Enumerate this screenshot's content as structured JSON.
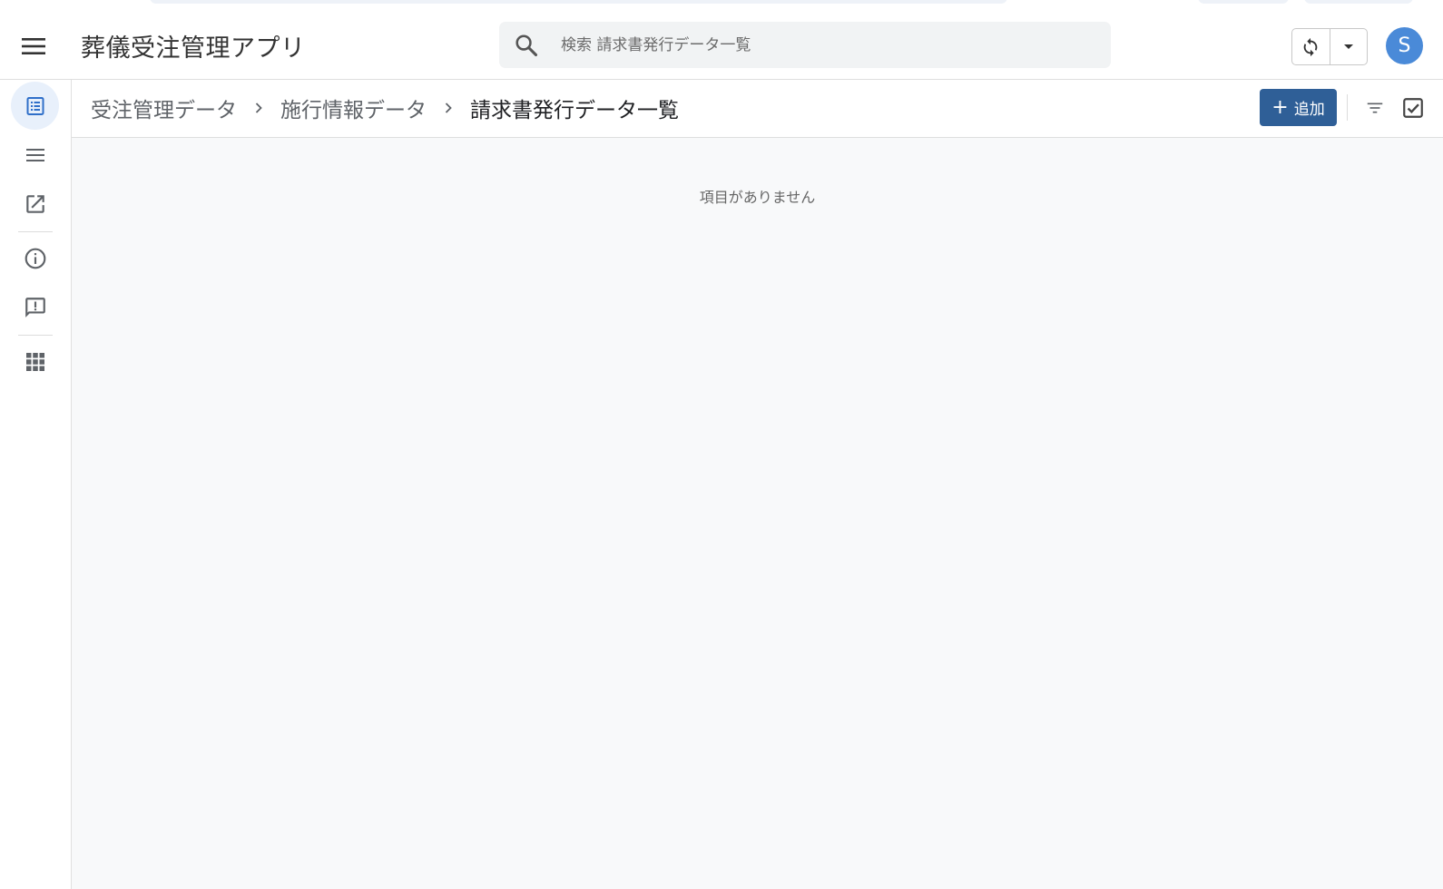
{
  "header": {
    "app_title": "葬儀受注管理アプリ",
    "search_placeholder": "検索 請求書発行データ一覧",
    "avatar_letter": "S"
  },
  "rail": {
    "items": [
      {
        "icon": "list-document-icon",
        "active": true
      },
      {
        "icon": "menu-lines-icon"
      },
      {
        "icon": "open-external-icon"
      },
      {
        "icon": "info-icon"
      },
      {
        "icon": "feedback-icon"
      },
      {
        "icon": "apps-grid-icon"
      }
    ]
  },
  "breadcrumb": {
    "items": [
      "受注管理データ",
      "施行情報データ",
      "請求書発行データ一覧"
    ]
  },
  "toolbar": {
    "add_label": "追加"
  },
  "content": {
    "empty_message": "項目がありません"
  },
  "colors": {
    "primary_button": "#2f5f97",
    "avatar": "#4a8ad8",
    "rail_active": "#e8f0fb",
    "content_bg": "#f8f9fa"
  }
}
